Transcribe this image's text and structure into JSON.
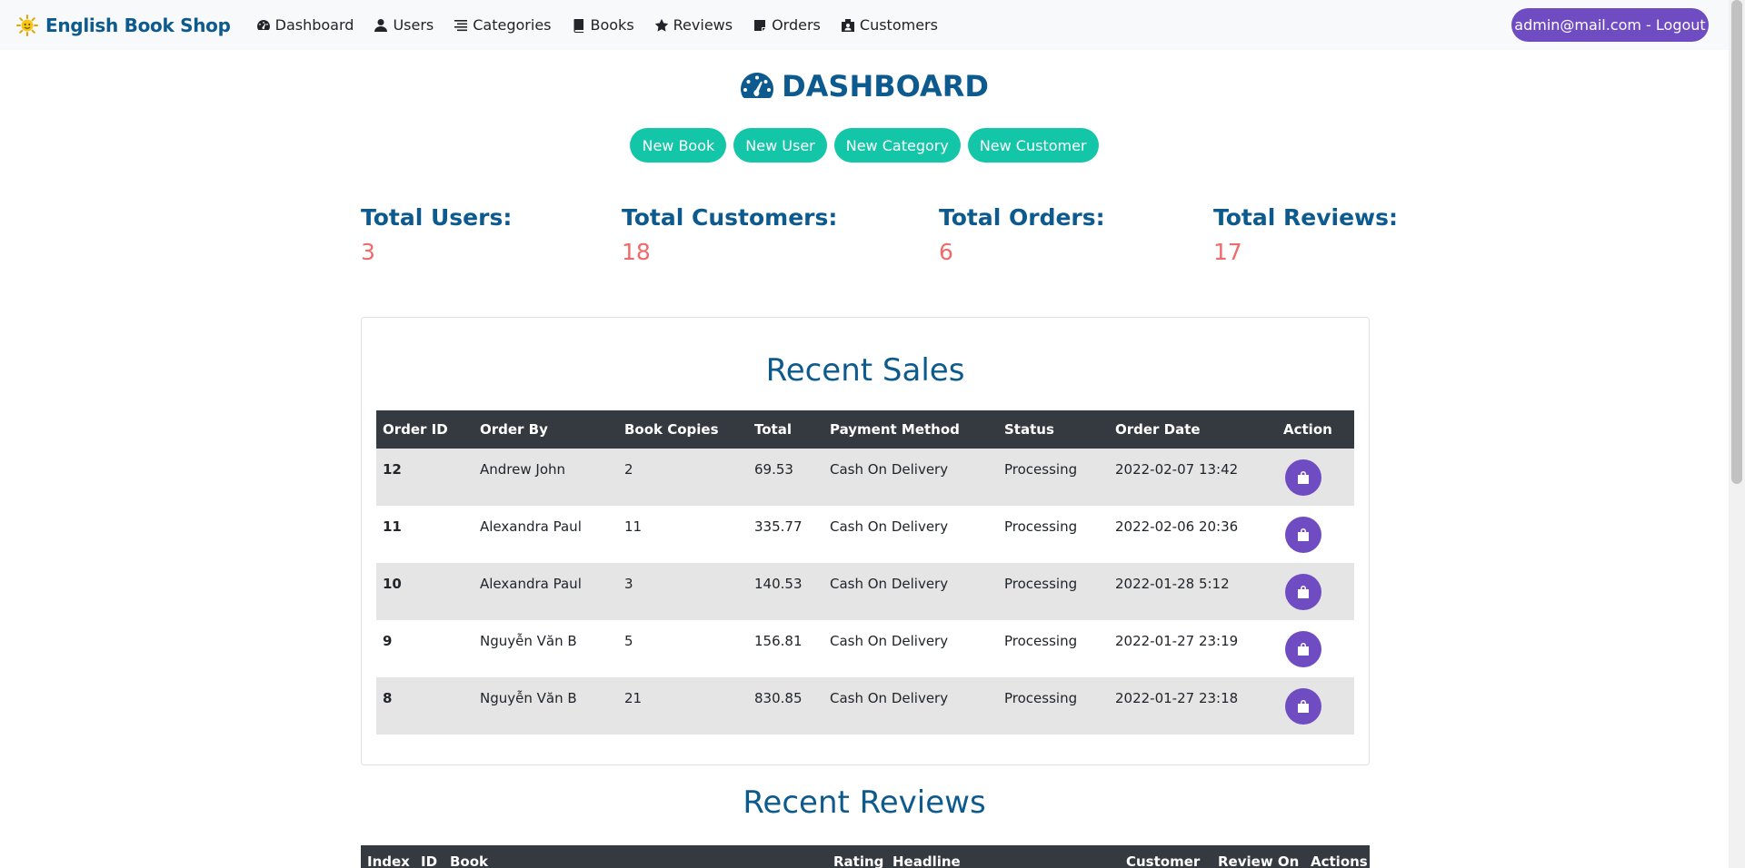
{
  "navbar": {
    "brand": "English Book Shop",
    "items": [
      {
        "label": "Dashboard",
        "icon": "dashboard-gauge-icon"
      },
      {
        "label": "Users",
        "icon": "user-icon"
      },
      {
        "label": "Categories",
        "icon": "list-icon"
      },
      {
        "label": "Books",
        "icon": "book-icon"
      },
      {
        "label": "Reviews",
        "icon": "star-icon"
      },
      {
        "label": "Orders",
        "icon": "sticky-note-icon"
      },
      {
        "label": "Customers",
        "icon": "address-card-icon"
      }
    ],
    "logout_label": "admin@mail.com - Logout"
  },
  "page": {
    "title": "DASHBOARD",
    "quick_actions": [
      "New Book",
      "New User",
      "New Category",
      "New Customer"
    ]
  },
  "stats": {
    "users_label": "Total Users:",
    "users_value": "3",
    "customers_label": "Total Customers:",
    "customers_value": "18",
    "orders_label": "Total Orders:",
    "orders_value": "6",
    "reviews_label": "Total Reviews:",
    "reviews_value": "17"
  },
  "recent_sales": {
    "title": "Recent Sales",
    "columns": [
      "Order ID",
      "Order By",
      "Book Copies",
      "Total",
      "Payment Method",
      "Status",
      "Order Date",
      "Action"
    ],
    "rows": [
      {
        "id": "12",
        "by": "Andrew John",
        "copies": "2",
        "total": "69.53",
        "payment": "Cash On Delivery",
        "status": "Processing",
        "date": "2022-02-07 13:42"
      },
      {
        "id": "11",
        "by": "Alexandra Paul",
        "copies": "11",
        "total": "335.77",
        "payment": "Cash On Delivery",
        "status": "Processing",
        "date": "2022-02-06 20:36"
      },
      {
        "id": "10",
        "by": "Alexandra Paul",
        "copies": "3",
        "total": "140.53",
        "payment": "Cash On Delivery",
        "status": "Processing",
        "date": "2022-01-28 5:12"
      },
      {
        "id": "9",
        "by": "Nguyễn Văn B",
        "copies": "5",
        "total": "156.81",
        "payment": "Cash On Delivery",
        "status": "Processing",
        "date": "2022-01-27 23:19"
      },
      {
        "id": "8",
        "by": "Nguyễn Văn B",
        "copies": "21",
        "total": "830.85",
        "payment": "Cash On Delivery",
        "status": "Processing",
        "date": "2022-01-27 23:18"
      }
    ]
  },
  "recent_reviews": {
    "title": "Recent Reviews",
    "columns": [
      "Index",
      "ID",
      "Book",
      "Rating",
      "Headline",
      "Customer",
      "Review On",
      "Actions"
    ]
  },
  "colors": {
    "brand": "#0d5a8e",
    "accent_green": "#14c6a8",
    "accent_purple": "#6f4cc2",
    "stat_value": "#ef6a6a",
    "table_header": "#343a40"
  }
}
